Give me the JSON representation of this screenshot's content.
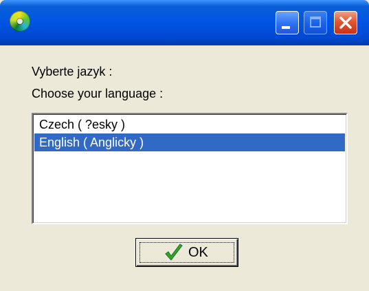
{
  "titlebar": {
    "app_icon": "cd-disc-icon",
    "controls": [
      "minimize-icon",
      "maximize-icon",
      "close-icon"
    ]
  },
  "dialog": {
    "prompt_czech": "Vyberte jazyk :",
    "prompt_english": "Choose your language :"
  },
  "language_list": {
    "items": [
      {
        "label": "Czech ( ?esky )",
        "selected": false
      },
      {
        "label": "English ( Anglicky )",
        "selected": true
      }
    ]
  },
  "ok_button": {
    "label": "OK",
    "icon": "checkmark-icon"
  },
  "colors": {
    "titlebar_blue": "#0054e3",
    "selection_blue": "#316ac5",
    "dialog_bg": "#ece9d8",
    "close_red": "#e2552e",
    "check_green": "#2fa82f"
  }
}
